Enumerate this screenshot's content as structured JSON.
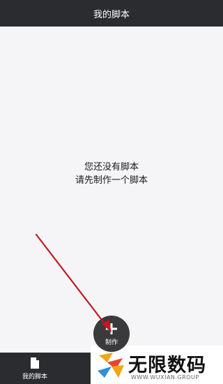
{
  "header": {
    "title": "我的脚本"
  },
  "empty_state": {
    "line1": "您还没有脚本",
    "line2": "请先制作一个脚本"
  },
  "fab": {
    "label": "制作",
    "icon": "plus-icon"
  },
  "tabbar": {
    "mine_label": "我的脚本",
    "mine_icon": "document-icon"
  },
  "annotation": {
    "arrow_color": "#c7161c"
  },
  "watermark": {
    "brand": "无限数码",
    "site": "WWW.WUXIAN.GROUP"
  },
  "colors": {
    "bar_bg": "#2b2c30",
    "content_bg": "#f5f5f8",
    "fab_bg": "#3a3a3d"
  }
}
